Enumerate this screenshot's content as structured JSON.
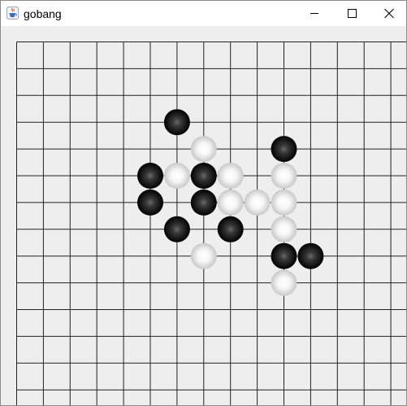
{
  "window": {
    "title": "gobang",
    "app_icon": "java-coffee-cup-icon",
    "controls": {
      "minimize": "minimize-icon",
      "maximize": "maximize-icon",
      "close": "close-icon"
    }
  },
  "board": {
    "columns": 15,
    "rows": 14,
    "line_color": "#222222",
    "background": "#eeeeee",
    "stones": [
      {
        "col": 6,
        "row": 3,
        "color": "black"
      },
      {
        "col": 7,
        "row": 4,
        "color": "white"
      },
      {
        "col": 10,
        "row": 4,
        "color": "black"
      },
      {
        "col": 5,
        "row": 5,
        "color": "black"
      },
      {
        "col": 6,
        "row": 5,
        "color": "white"
      },
      {
        "col": 7,
        "row": 5,
        "color": "black"
      },
      {
        "col": 8,
        "row": 5,
        "color": "white"
      },
      {
        "col": 10,
        "row": 5,
        "color": "white"
      },
      {
        "col": 5,
        "row": 6,
        "color": "black"
      },
      {
        "col": 7,
        "row": 6,
        "color": "black"
      },
      {
        "col": 8,
        "row": 6,
        "color": "white"
      },
      {
        "col": 9,
        "row": 6,
        "color": "white"
      },
      {
        "col": 10,
        "row": 6,
        "color": "white"
      },
      {
        "col": 6,
        "row": 7,
        "color": "black"
      },
      {
        "col": 8,
        "row": 7,
        "color": "black"
      },
      {
        "col": 10,
        "row": 7,
        "color": "white"
      },
      {
        "col": 7,
        "row": 8,
        "color": "white"
      },
      {
        "col": 10,
        "row": 8,
        "color": "black"
      },
      {
        "col": 11,
        "row": 8,
        "color": "black"
      },
      {
        "col": 10,
        "row": 9,
        "color": "white"
      }
    ]
  }
}
